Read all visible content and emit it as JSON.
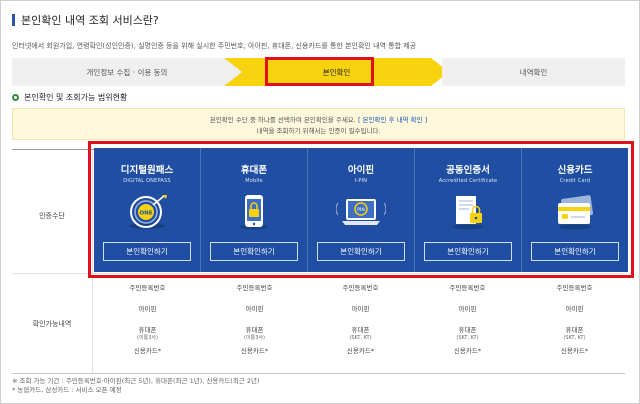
{
  "header": {
    "title": "본인확인 내역 조회 서비스란?",
    "intro": "인터넷에서 회원가입, 연령확인(성인인증), 실명인증 등을 위해 실시한 주민번호, 아이핀, 휴대폰, 신용카드를 통한 본인확인 내역 통합 제공"
  },
  "steps": [
    {
      "label": "개인정보 수집 · 이용 동의",
      "active": false
    },
    {
      "label": "본인확인",
      "active": true
    },
    {
      "label": "내역확인",
      "active": false
    }
  ],
  "section_title": "본인확인 및 조회가능 범위현황",
  "notice": {
    "line1_pre": "본인확인 수단 중 하나를 선택하여 본인확인을 주세요.",
    "line1_hl": "[ 본인확인 후 내역 확인 ]",
    "line2": "내역을 조회하기 위해서는 인증이 필수입니다."
  },
  "table": {
    "row1_label": "인증수단",
    "row2_label": "확인가능내역"
  },
  "methods": [
    {
      "name": "디지털원패스",
      "sub": "DIGITAL ONEPASS",
      "button": "본인확인하기",
      "icon": "target-onepass-icon",
      "available": [
        "주민등록번호",
        "아이핀",
        "휴대폰",
        "신용카드*"
      ],
      "phone_note": "(이통3사)"
    },
    {
      "name": "휴대폰",
      "sub": "Mobile",
      "button": "본인확인하기",
      "icon": "mobile-lock-icon",
      "available": [
        "주민등록번호",
        "아이핀",
        "휴대폰",
        "신용카드*"
      ],
      "phone_note": "(이통3사)"
    },
    {
      "name": "아이핀",
      "sub": "I-PIN",
      "button": "본인확인하기",
      "icon": "laptop-ipin-icon",
      "available": [
        "주민등록번호",
        "아이핀",
        "휴대폰",
        "신용카드*"
      ],
      "phone_note": "(SKT, KT)"
    },
    {
      "name": "공동인증서",
      "sub": "Accredited Certificate",
      "button": "본인확인하기",
      "icon": "certificate-icon",
      "available": [
        "주민등록번호",
        "아이핀",
        "휴대폰",
        "신용카드*"
      ],
      "phone_note": "(SKT, KT)"
    },
    {
      "name": "신용카드",
      "sub": "Credit Card",
      "button": "본인확인하기",
      "icon": "credit-card-icon",
      "available": [
        "주민등록번호",
        "아이핀",
        "휴대폰",
        "신용카드*"
      ],
      "phone_note": "(SKT, KT)"
    }
  ],
  "footnotes": [
    "※ 조회 가능 기간 : 주민등록번호·아이핀(최근 5년), 휴대폰(최근 1년), 신용카드(최근 2년)",
    "* 농협카드, 삼성카드 : 서비스 오픈 예정"
  ],
  "colors": {
    "accent_blue": "#1f4ea3",
    "step_yellow": "#f7d20f",
    "highlight_red": "#e0101a"
  }
}
